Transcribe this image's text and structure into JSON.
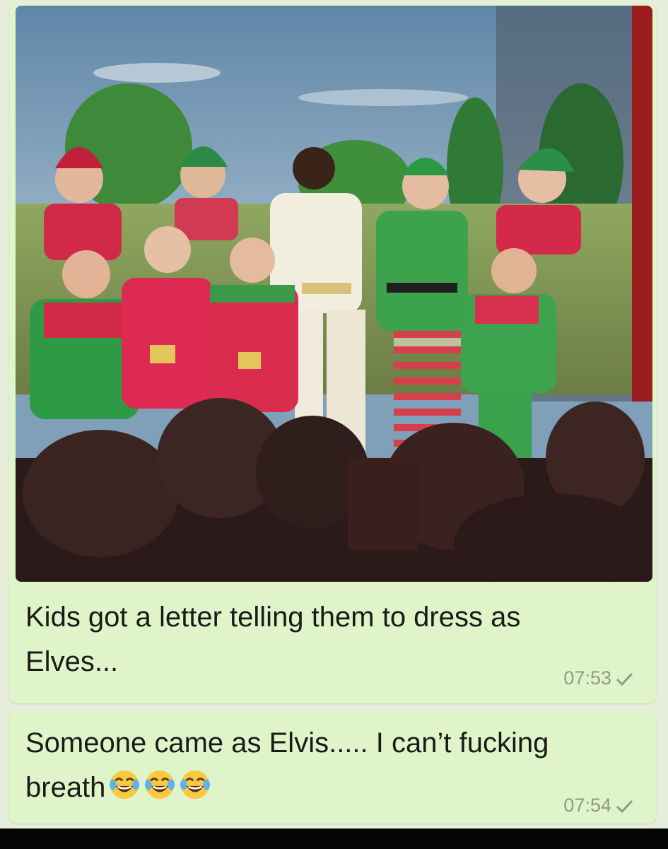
{
  "messages": [
    {
      "has_photo": true,
      "text": "Kids got a letter telling them to dress as Elves...",
      "time": "07:53",
      "status": "sent"
    },
    {
      "has_photo": false,
      "text": "Someone came as Elvis..... I can’t fucking breath",
      "emojis": [
        "face-with-tears-of-joy",
        "face-with-tears-of-joy",
        "face-with-tears-of-joy"
      ],
      "time": "07:54",
      "status": "sent"
    }
  ],
  "colors": {
    "bubble": "#dff5c9",
    "chat_background": "#e6eedb",
    "timestamp": "#8e9a8a",
    "elf_red": "#d8294a",
    "elf_green": "#2f9a45"
  }
}
